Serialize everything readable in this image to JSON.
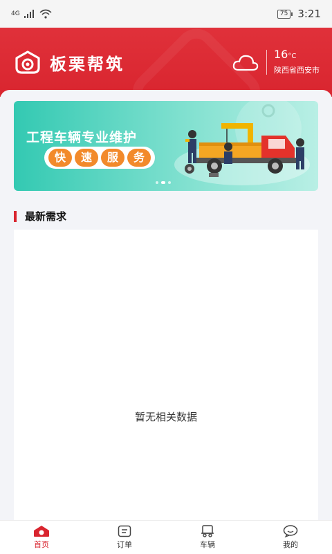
{
  "status": {
    "network": "4G",
    "battery": "75",
    "time": "3:21"
  },
  "header": {
    "title": "板栗帮筑",
    "weather": {
      "temp": "16",
      "unit": "°C",
      "city": "陕西省西安市",
      "icon": "cloud-icon"
    }
  },
  "banner": {
    "title": "工程车辆专业维护",
    "subtitle_chars": [
      "快",
      "速",
      "服",
      "务"
    ]
  },
  "section": {
    "title": "最新需求"
  },
  "empty": {
    "text": "暂无相关数据"
  },
  "tabs": [
    {
      "label": "首页",
      "icon": "home-icon",
      "active": true
    },
    {
      "label": "订单",
      "icon": "order-icon",
      "active": false
    },
    {
      "label": "车辆",
      "icon": "vehicle-icon",
      "active": false
    },
    {
      "label": "我的",
      "icon": "profile-icon",
      "active": false
    }
  ],
  "colors": {
    "brand": "#d9252f",
    "banner_accent": "#f28a2b",
    "banner_bg": "#33c9b2"
  }
}
